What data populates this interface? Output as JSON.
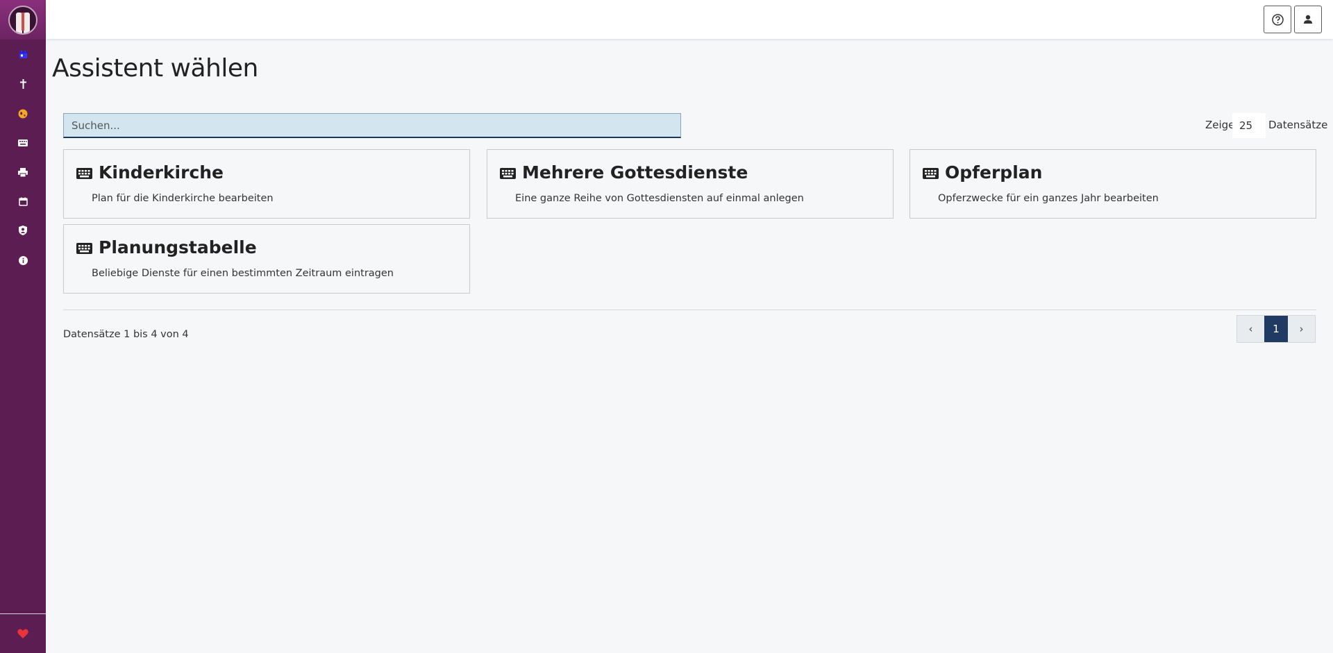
{
  "app": {
    "page_title": "Assistent wählen"
  },
  "sidebar": {
    "items": [
      {
        "name": "calendar-icon",
        "color": "#3333ff"
      },
      {
        "name": "cross-icon",
        "color": "#ffffff"
      },
      {
        "name": "globe-icon",
        "color": "#f5a623"
      },
      {
        "name": "keyboard-icon",
        "color": "#ffffff"
      },
      {
        "name": "print-icon",
        "color": "#ffffff"
      },
      {
        "name": "calendar-outline-icon",
        "color": "#ffffff"
      },
      {
        "name": "user-shield-icon",
        "color": "#ffffff"
      },
      {
        "name": "info-icon",
        "color": "#ffffff"
      }
    ],
    "bottom_item": {
      "name": "heart-icon",
      "color": "#e8333b"
    }
  },
  "topbar": {
    "help_icon": "help-icon",
    "user_icon": "user-icon"
  },
  "search": {
    "placeholder": "Suchen...",
    "value": ""
  },
  "length": {
    "prefix": "Zeige",
    "value": "25",
    "suffix": "Datensätze"
  },
  "cards": [
    {
      "title": "Kinderkirche",
      "description": "Plan für die Kinderkirche bearbeiten",
      "icon": "keyboard-icon"
    },
    {
      "title": "Mehrere Gottesdienste",
      "description": "Eine ganze Reihe von Gottesdiensten auf einmal anlegen",
      "icon": "keyboard-icon"
    },
    {
      "title": "Opferplan",
      "description": "Opferzwecke für ein ganzes Jahr bearbeiten",
      "icon": "keyboard-icon"
    },
    {
      "title": "Planungstabelle",
      "description": "Beliebige Dienste für einen bestimmten Zeitraum eintragen",
      "icon": "keyboard-icon"
    }
  ],
  "footer": {
    "records_info": "Datensätze 1 bis 4 von 4"
  },
  "pagination": {
    "prev": "‹",
    "current": "1",
    "next": "›"
  },
  "colors": {
    "sidebar": "#5b1d52",
    "accent": "#1f3a63",
    "search_bg": "#d3e6f0"
  }
}
